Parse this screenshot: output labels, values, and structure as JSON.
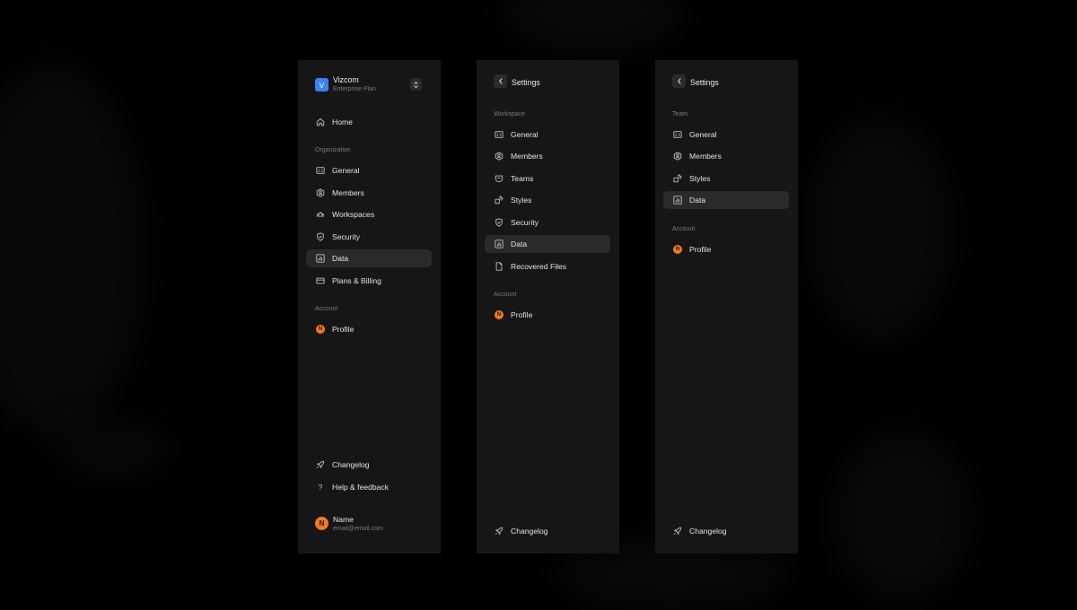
{
  "colors": {
    "background": "#000000",
    "panel": "#161616",
    "active_item": "#2a2a2a",
    "workspace_logo": "#3b82f6",
    "avatar": "#f07a23"
  },
  "panel1": {
    "workspace": {
      "initial": "V",
      "name": "Vizcom",
      "plan": "Enterprise Plan",
      "switch_icon": "chevron-up-down-icon"
    },
    "home": {
      "label": "Home",
      "icon": "home-icon"
    },
    "org_section": "Organization",
    "org_items": [
      {
        "label": "General",
        "icon": "general-icon"
      },
      {
        "label": "Members",
        "icon": "members-icon"
      },
      {
        "label": "Workspaces",
        "icon": "workspaces-icon"
      },
      {
        "label": "Security",
        "icon": "shield-icon"
      },
      {
        "label": "Data",
        "icon": "chart-icon",
        "active": true
      },
      {
        "label": "Plans & Billing",
        "icon": "card-icon"
      }
    ],
    "account_section": "Account",
    "account_items": [
      {
        "label": "Profile",
        "avatar_initial": "N"
      }
    ],
    "changelog": {
      "label": "Changelog",
      "icon": "rocket-icon"
    },
    "help": {
      "label": "Help & feedback",
      "icon": "question-icon",
      "glyph": "?"
    },
    "user": {
      "initial": "N",
      "name": "Name",
      "email": "email@email.com"
    }
  },
  "panel2": {
    "back_icon": "chevron-left-icon",
    "title": "Settings",
    "workspace_section": "Workspace",
    "workspace_items": [
      {
        "label": "General",
        "icon": "general-icon"
      },
      {
        "label": "Members",
        "icon": "members-icon"
      },
      {
        "label": "Teams",
        "icon": "teams-icon"
      },
      {
        "label": "Styles",
        "icon": "styles-icon"
      },
      {
        "label": "Security",
        "icon": "shield-icon"
      },
      {
        "label": "Data",
        "icon": "chart-icon",
        "active": true
      },
      {
        "label": "Recovered Files",
        "icon": "file-icon"
      }
    ],
    "account_section": "Account",
    "account_items": [
      {
        "label": "Profile",
        "avatar_initial": "N"
      }
    ],
    "changelog": {
      "label": "Changelog",
      "icon": "rocket-icon"
    }
  },
  "panel3": {
    "back_icon": "chevron-left-icon",
    "title": "Settings",
    "team_section": "Team",
    "team_items": [
      {
        "label": "General",
        "icon": "general-icon"
      },
      {
        "label": "Members",
        "icon": "members-icon"
      },
      {
        "label": "Styles",
        "icon": "styles-icon"
      },
      {
        "label": "Data",
        "icon": "chart-icon",
        "active": true
      }
    ],
    "account_section": "Account",
    "account_items": [
      {
        "label": "Profile",
        "avatar_initial": "N"
      }
    ],
    "changelog": {
      "label": "Changelog",
      "icon": "rocket-icon"
    }
  }
}
